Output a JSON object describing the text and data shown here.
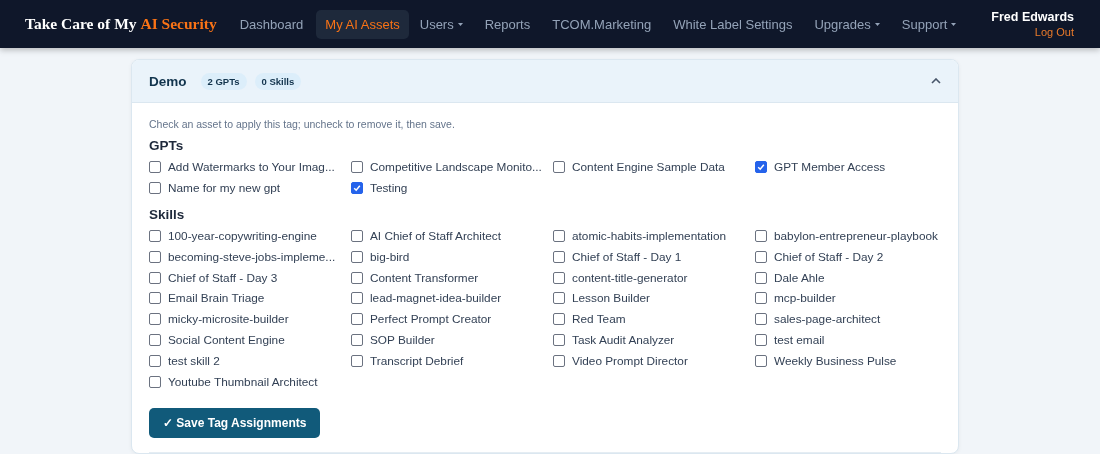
{
  "brand": {
    "prefix": "Take Care of My",
    "highlight": "AI Security"
  },
  "nav": [
    {
      "label": "Dashboard",
      "selected": false,
      "dropdown": false
    },
    {
      "label": "My AI Assets",
      "selected": true,
      "dropdown": false
    },
    {
      "label": "Users",
      "selected": false,
      "dropdown": true
    },
    {
      "label": "Reports",
      "selected": false,
      "dropdown": false
    },
    {
      "label": "TCOM.Marketing",
      "selected": false,
      "dropdown": false
    },
    {
      "label": "White Label Settings",
      "selected": false,
      "dropdown": false
    },
    {
      "label": "Upgrades",
      "selected": false,
      "dropdown": true
    },
    {
      "label": "Support",
      "selected": false,
      "dropdown": true
    }
  ],
  "user": {
    "name": "Fred Edwards",
    "logout": "Log Out"
  },
  "tag_panel": {
    "title": "Demo",
    "badges": [
      "2 GPTs",
      "0 Skills"
    ],
    "expanded": true,
    "hint": "Check an asset to apply this tag; uncheck to remove it, then save.",
    "sections": [
      {
        "title": "GPTs",
        "items": [
          {
            "label": "Add Watermarks to Your Imag...",
            "checked": false
          },
          {
            "label": "Competitive Landscape Monito...",
            "checked": false
          },
          {
            "label": "Content Engine Sample Data",
            "checked": false
          },
          {
            "label": "GPT Member Access",
            "checked": true
          },
          {
            "label": "Name for my new gpt",
            "checked": false
          },
          {
            "label": "Testing",
            "checked": true
          }
        ]
      },
      {
        "title": "Skills",
        "items": [
          {
            "label": "100-year-copywriting-engine",
            "checked": false
          },
          {
            "label": "AI Chief of Staff Architect",
            "checked": false
          },
          {
            "label": "atomic-habits-implementation",
            "checked": false
          },
          {
            "label": "babylon-entrepreneur-playbook",
            "checked": false
          },
          {
            "label": "becoming-steve-jobs-impleme...",
            "checked": false
          },
          {
            "label": "big-bird",
            "checked": false
          },
          {
            "label": "Chief of Staff - Day 1",
            "checked": false
          },
          {
            "label": "Chief of Staff - Day 2",
            "checked": false
          },
          {
            "label": "Chief of Staff - Day 3",
            "checked": false
          },
          {
            "label": "Content Transformer",
            "checked": false
          },
          {
            "label": "content-title-generator",
            "checked": false
          },
          {
            "label": "Dale Ahle",
            "checked": false
          },
          {
            "label": "Email Brain Triage",
            "checked": false
          },
          {
            "label": "lead-magnet-idea-builder",
            "checked": false
          },
          {
            "label": "Lesson Builder",
            "checked": false
          },
          {
            "label": "mcp-builder",
            "checked": false
          },
          {
            "label": "micky-microsite-builder",
            "checked": false
          },
          {
            "label": "Perfect Prompt Creator",
            "checked": false
          },
          {
            "label": "Red Team",
            "checked": false
          },
          {
            "label": "sales-page-architect",
            "checked": false
          },
          {
            "label": "Social Content Engine",
            "checked": false
          },
          {
            "label": "SOP Builder",
            "checked": false
          },
          {
            "label": "Task Audit Analyzer",
            "checked": false
          },
          {
            "label": "test email",
            "checked": false
          },
          {
            "label": "test skill 2",
            "checked": false
          },
          {
            "label": "Transcript Debrief",
            "checked": false
          },
          {
            "label": "Video Prompt Director",
            "checked": false
          },
          {
            "label": "Weekly Business Pulse",
            "checked": false
          },
          {
            "label": "Youtube Thumbnail Architect",
            "checked": false
          }
        ]
      }
    ],
    "save_button": "✓ Save Tag Assignments"
  }
}
